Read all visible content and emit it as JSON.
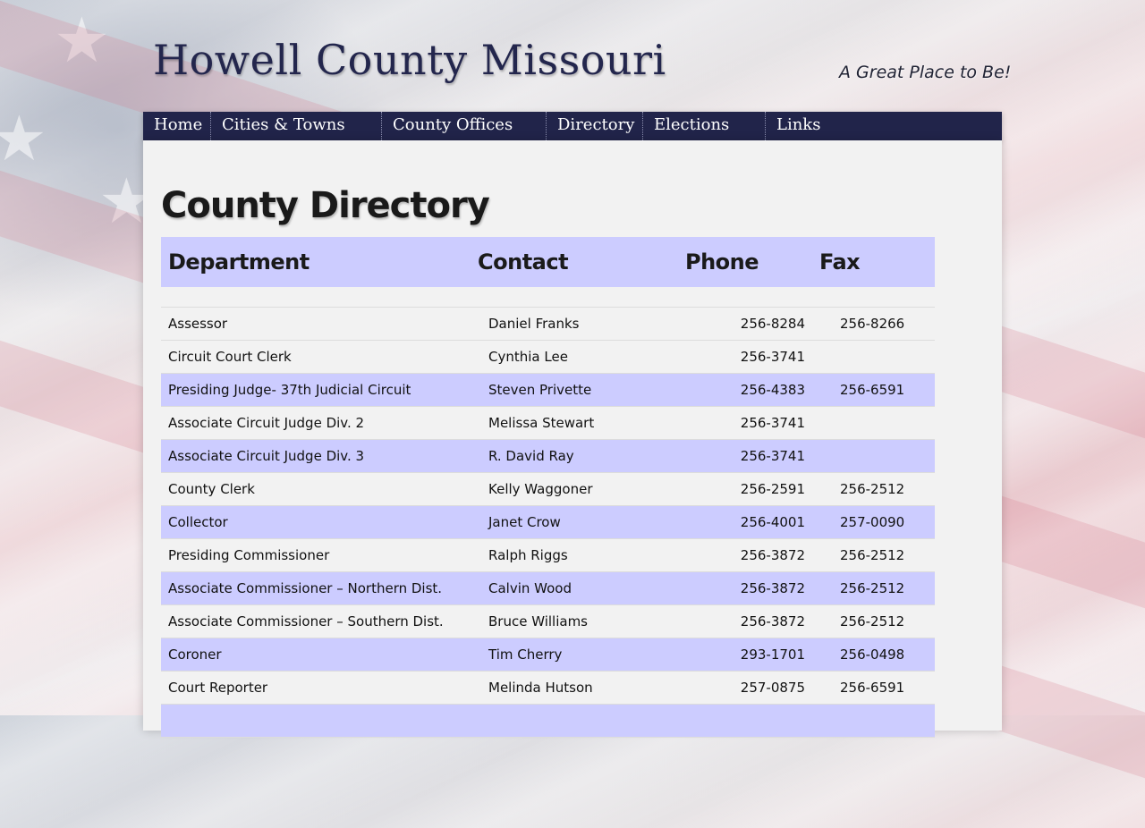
{
  "site": {
    "title": "Howell County Missouri",
    "tagline": "A Great Place to Be!"
  },
  "nav": {
    "items": [
      {
        "label": "Home"
      },
      {
        "label": "Cities & Towns"
      },
      {
        "label": "County Offices"
      },
      {
        "label": "Directory"
      },
      {
        "label": "Elections"
      },
      {
        "label": "Links"
      }
    ]
  },
  "page": {
    "title": "County Directory"
  },
  "table": {
    "headers": {
      "department": "Department",
      "contact": "Contact",
      "phone": "Phone",
      "fax": "Fax"
    },
    "rows": [
      {
        "department": "Assessor",
        "contact": "Daniel Franks",
        "phone": "256-8284",
        "fax": "256-8266"
      },
      {
        "department": "Circuit Court Clerk",
        "contact": "Cynthia Lee",
        "phone": "256-3741",
        "fax": ""
      },
      {
        "department": "Presiding Judge- 37th Judicial Circuit",
        "contact": "Steven Privette",
        "phone": "256-4383",
        "fax": "256-6591"
      },
      {
        "department": "Associate Circuit Judge Div. 2",
        "contact": "Melissa Stewart",
        "phone": "256-3741",
        "fax": ""
      },
      {
        "department": "Associate Circuit Judge Div. 3",
        "contact": "R. David Ray",
        "phone": "256-3741",
        "fax": ""
      },
      {
        "department": "County Clerk",
        "contact": "Kelly Waggoner",
        "phone": "256-2591",
        "fax": "256-2512"
      },
      {
        "department": "Collector",
        "contact": "Janet Crow",
        "phone": "256-4001",
        "fax": "257-0090"
      },
      {
        "department": "Presiding Commissioner",
        "contact": "Ralph Riggs",
        "phone": "256-3872",
        "fax": "256-2512"
      },
      {
        "department": "Associate Commissioner – Northern Dist.",
        "contact": "Calvin Wood",
        "phone": "256-3872",
        "fax": "256-2512"
      },
      {
        "department": "Associate Commissioner – Southern Dist.",
        "contact": "Bruce Williams",
        "phone": "256-3872",
        "fax": "256-2512"
      },
      {
        "department": "Coroner",
        "contact": "Tim Cherry",
        "phone": "293-1701",
        "fax": "256-0498"
      },
      {
        "department": "Court Reporter",
        "contact": " Melinda Hutson",
        "phone": "257-0875",
        "fax": "256-6591"
      }
    ]
  },
  "colors": {
    "nav_background": "#21244a",
    "row_highlight": "#ccccff",
    "title": "#23264d"
  }
}
